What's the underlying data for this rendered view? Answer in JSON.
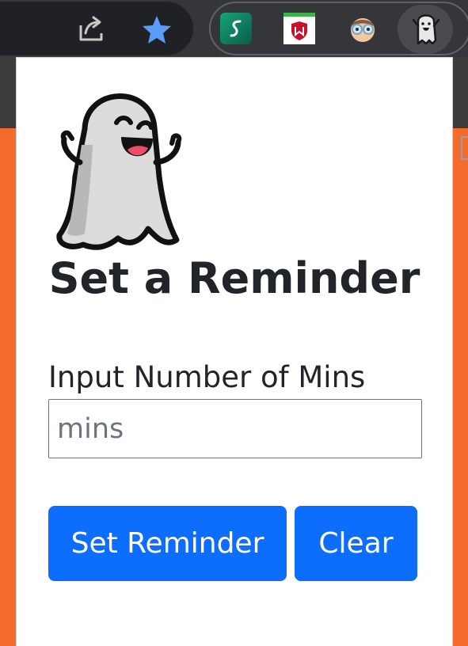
{
  "toolbar": {
    "icons": [
      "share-icon",
      "bookmark-star-icon",
      "extension-s-icon",
      "extension-shield-icon",
      "extension-face-icon",
      "extension-ghost-icon"
    ],
    "star_color": "#5b9cf6"
  },
  "popup": {
    "mascot_icon": "ghost-icon",
    "title": "Set a Reminder",
    "field_label": "Input Number of Mins",
    "input": {
      "value": "",
      "placeholder": "mins"
    },
    "buttons": {
      "set_label": "Set Reminder",
      "clear_label": "Clear"
    },
    "accent_color": "#0d6efd"
  },
  "page_background": "#f36c2b"
}
